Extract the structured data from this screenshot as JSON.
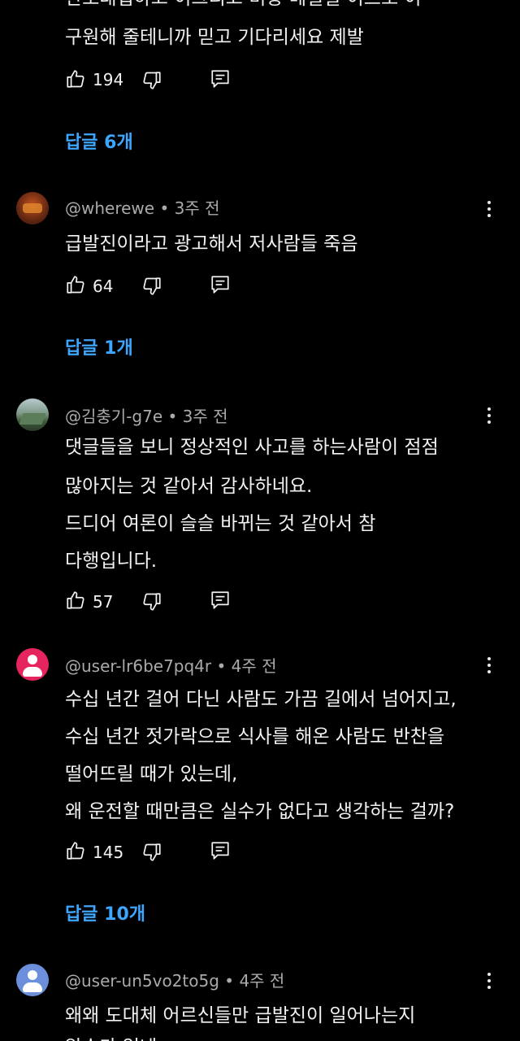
{
  "top_comment": {
    "partial_line": "한도대접하고 이그디고 미항 메일일 이르모 이",
    "line": "구원해 줄테니까 믿고 기다리세요 제발",
    "likes": "194",
    "replies_label": "답글 6개"
  },
  "comments": [
    {
      "author": "@wherewe",
      "time": "3주 전",
      "lines": [
        "급발진이라고 광고해서 저사람들 죽음"
      ],
      "likes": "64",
      "replies_label": "답글 1개"
    },
    {
      "author": "@김충기-g7e",
      "time": "3주 전",
      "lines": [
        "댓글들을 보니 정상적인 사고를 하는사람이 점점",
        "많아지는 것 같아서 감사하네요.",
        "드디어 여론이 슬슬 바뀌는 것 같아서 참",
        "다행입니다."
      ],
      "likes": "57"
    },
    {
      "author": "@user-lr6be7pq4r",
      "time": "4주 전",
      "lines": [
        "수십 년간 걸어 다닌 사람도 가끔 길에서 넘어지고,",
        "수십 년간 젓가락으로 식사를 해온 사람도 반찬을",
        "떨어뜨릴 때가 있는데,",
        "왜 운전할 때만큼은 실수가 없다고 생각하는 걸까?"
      ],
      "likes": "145",
      "replies_label": "답글 10개"
    },
    {
      "author": "@user-un5vo2to5g",
      "time": "4주 전",
      "lines": [
        "왜왜 도대체 어르신들만 급발진이 일어나는지",
        "알수가 없네"
      ]
    }
  ],
  "separator": "•",
  "icons": {
    "like": "thumbs-up-icon",
    "dislike": "thumbs-down-icon",
    "reply": "reply-comment-icon",
    "more": "more-vertical-icon"
  },
  "colors": {
    "background": "#000000",
    "text": "#f1f1f1",
    "meta": "#aaaaaa",
    "link": "#3ea6ff",
    "avatar_pink": "#e6255f",
    "avatar_blue": "#6c8fdc"
  }
}
